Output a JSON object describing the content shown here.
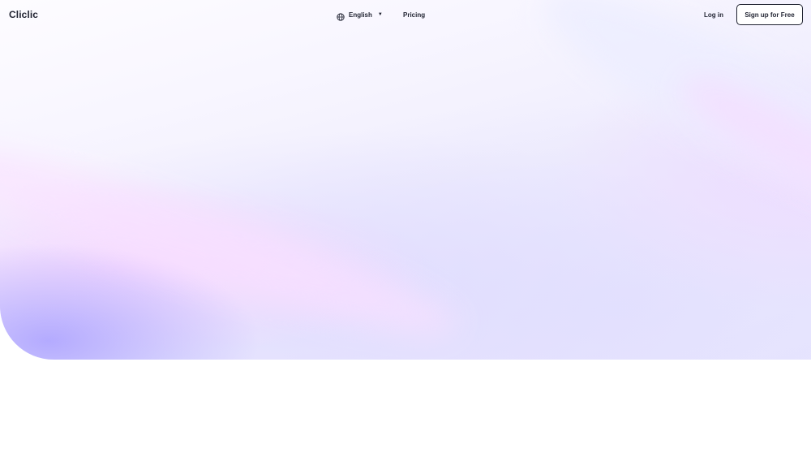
{
  "header": {
    "logo": "Cliclic",
    "language": {
      "icon": "globe-icon",
      "label": "English",
      "caret_icon": "caret-down-icon"
    },
    "pricing_label": "Pricing",
    "login_label": "Log in",
    "signup_label": "Sign up for Free"
  },
  "colors": {
    "text": "#1f2230",
    "hero_accent": "#aaa0ff",
    "hero_pink": "#f5d7ff",
    "background": "#ffffff"
  }
}
